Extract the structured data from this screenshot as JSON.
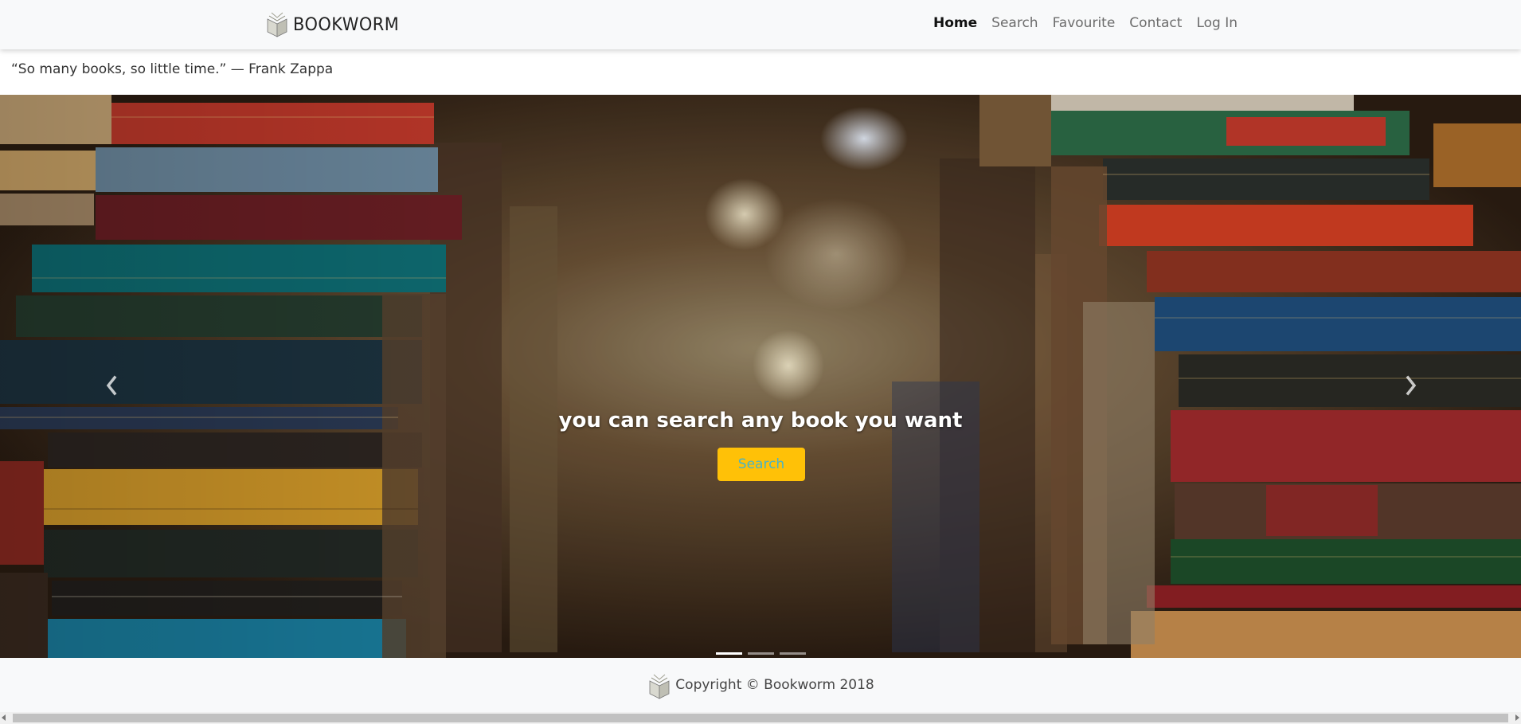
{
  "navbar": {
    "brand": "BOOKWORM",
    "links": [
      {
        "label": "Home",
        "active": true
      },
      {
        "label": "Search",
        "active": false
      },
      {
        "label": "Favourite",
        "active": false
      },
      {
        "label": "Contact",
        "active": false
      },
      {
        "label": "Log In",
        "active": false
      }
    ]
  },
  "quote": "“So many books, so little time.” — Frank Zappa",
  "carousel": {
    "caption": "you can search any book you want",
    "button_label": "Search",
    "prev_icon": "chevron-left-icon",
    "next_icon": "chevron-right-icon",
    "slides_total": 3,
    "active_slide": 1
  },
  "footer": {
    "copyright": "Copyright © Bookworm 2018"
  },
  "colors": {
    "accent": "#ffc107",
    "button_text": "#4ab3c6",
    "navbar_bg": "#f8f9fa"
  }
}
